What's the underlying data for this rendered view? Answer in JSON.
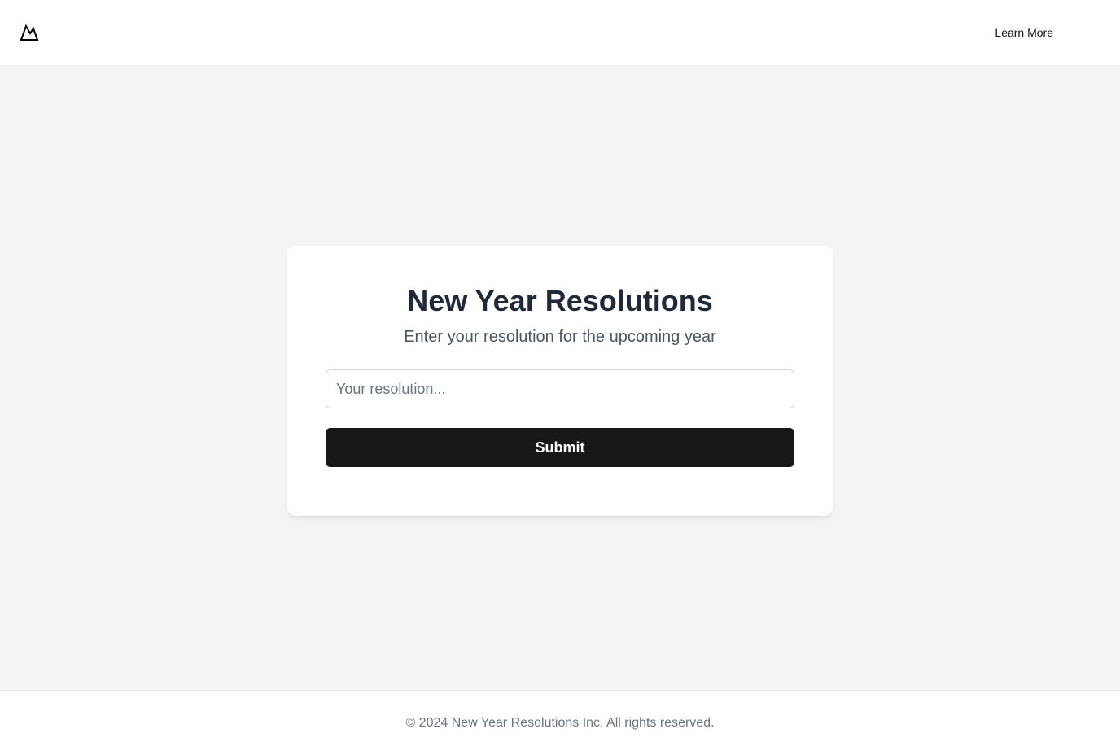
{
  "header": {
    "logo_icon": "mountain-icon",
    "nav_link_label": "Learn More"
  },
  "card": {
    "title": "New Year Resolutions",
    "subtitle": "Enter your resolution for the upcoming year",
    "input": {
      "value": "",
      "placeholder": "Your resolution..."
    },
    "submit_label": "Submit"
  },
  "footer": {
    "copyright": "© 2024 New Year Resolutions Inc. All rights reserved."
  },
  "colors": {
    "background": "#f3f4f6",
    "button": "#18181b",
    "title": "#1f2937",
    "subtitle": "#4b5563",
    "muted": "#6b7280"
  }
}
